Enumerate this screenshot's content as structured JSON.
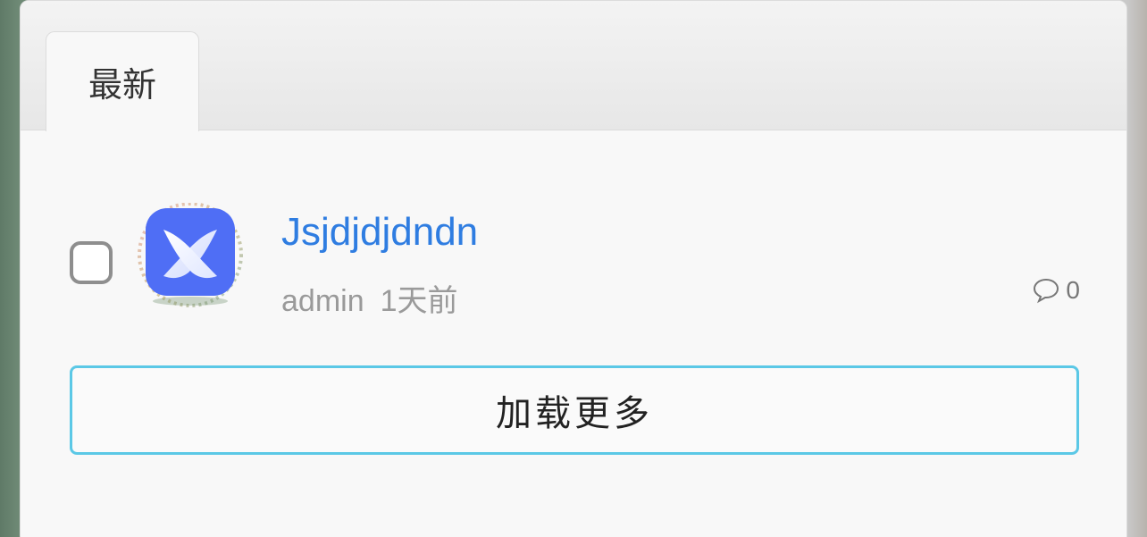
{
  "tabs": [
    {
      "label": "最新",
      "active": true
    }
  ],
  "topics": [
    {
      "title": "Jsjdjdjdndn",
      "author": "admin",
      "time": "1天前",
      "comment_count": "0",
      "avatar_icon": "x-logo-icon",
      "checked": false
    }
  ],
  "load_more_label": "加载更多",
  "colors": {
    "title_link": "#2f7de1",
    "meta_text": "#9a9a9a",
    "load_more_border": "#5bc8e6",
    "avatar_blue": "#4f6ef5"
  }
}
